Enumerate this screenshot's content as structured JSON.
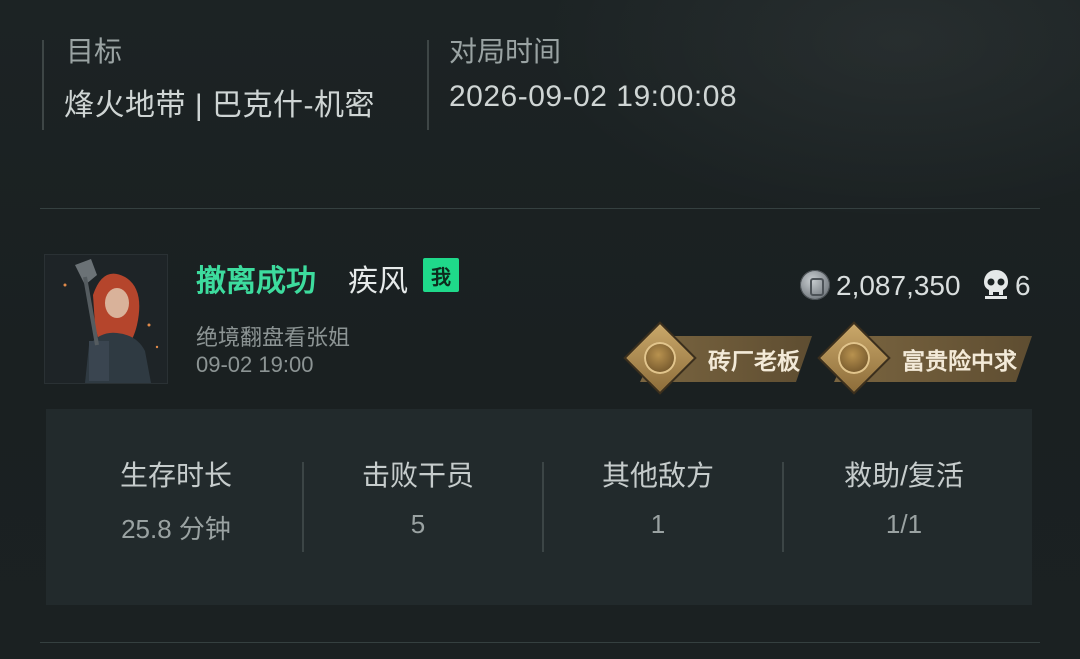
{
  "header": {
    "target_label": "目标",
    "target_value": "烽火地带 | 巴克什-机密",
    "time_label": "对局时间",
    "time_value": "2026-09-02 19:00:08"
  },
  "player": {
    "status": "撤离成功",
    "name": "疾风",
    "me_badge": "我",
    "subtitle": "绝境翻盘看张姐",
    "time": "09-02 19:00",
    "money": "2,087,350",
    "money_icon": "coin-icon",
    "kills": "6",
    "kills_icon": "skull-icon",
    "titles": [
      "砖厂老板",
      "富贵险中求"
    ]
  },
  "stats": [
    {
      "label": "生存时长",
      "value": "25.8 分钟"
    },
    {
      "label": "击败干员",
      "value": "5"
    },
    {
      "label": "其他敌方",
      "value": "1"
    },
    {
      "label": "救助/复活",
      "value": "1/1"
    }
  ],
  "colors": {
    "status_green": "#3ddc9e",
    "badge_green": "#1fd98a",
    "title_gold": "#7a6540"
  }
}
